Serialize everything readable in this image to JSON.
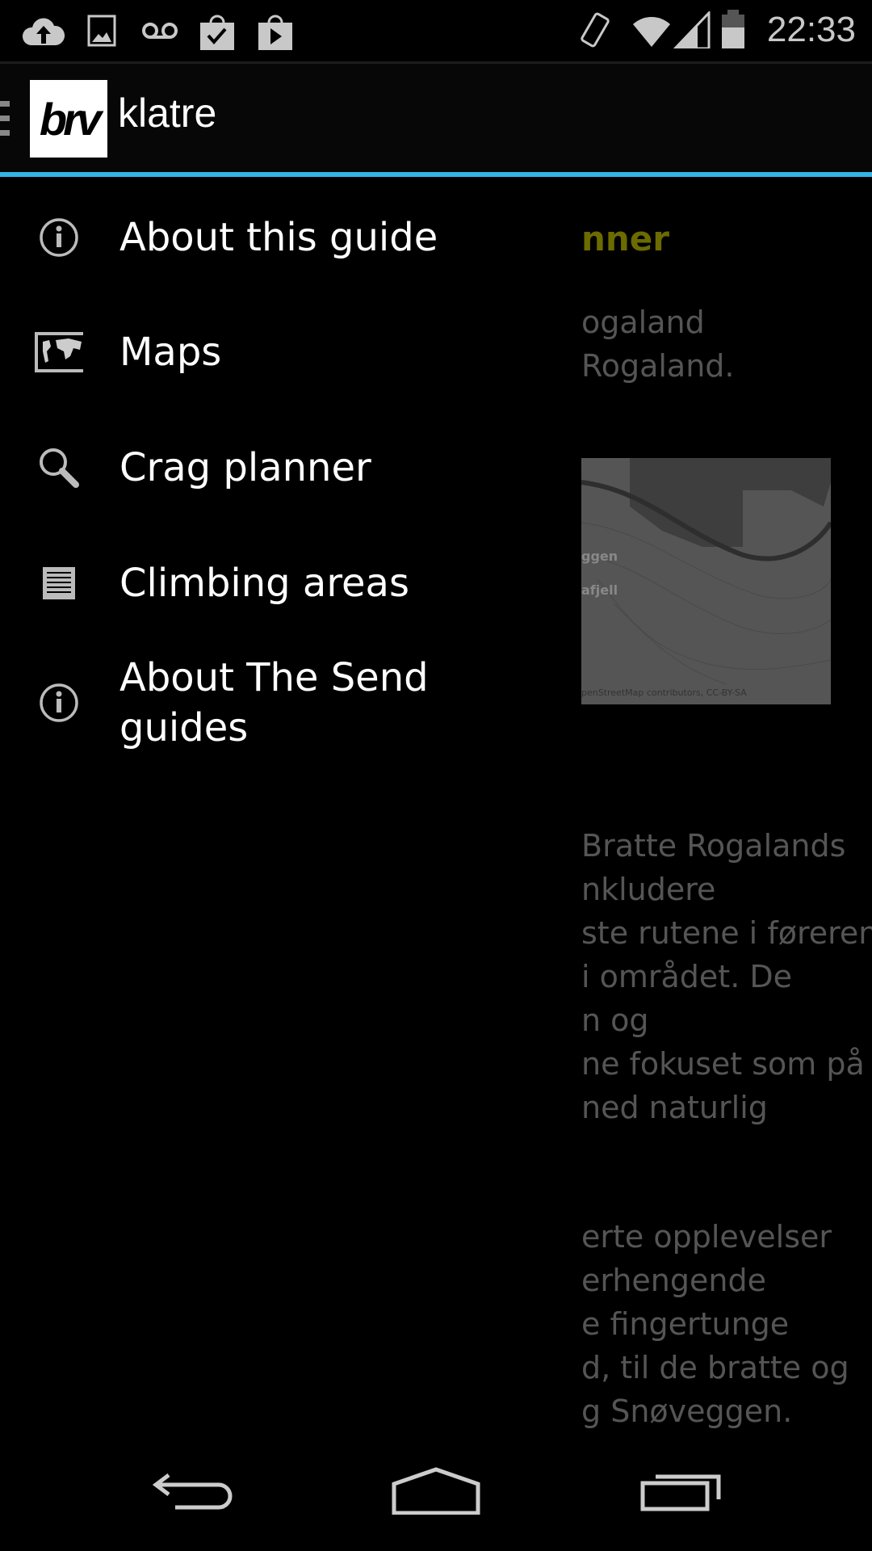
{
  "status_bar": {
    "icons_left": [
      "cloud-upload-icon",
      "image-icon",
      "voicemail-icon",
      "task-bag-icon",
      "play-store-icon"
    ],
    "icons_right": [
      "rotate-icon",
      "wifi-icon",
      "signal-icon",
      "battery-icon"
    ],
    "time": "22:33"
  },
  "action_bar": {
    "logo_text": "brv",
    "title": "klatre",
    "accent_color": "#33b5e5"
  },
  "drawer": {
    "items": [
      {
        "label": "About this guide",
        "icon": "info-icon"
      },
      {
        "label": "Maps",
        "icon": "world-map-icon"
      },
      {
        "label": "Crag planner",
        "icon": "search-icon"
      },
      {
        "label": "Climbing areas",
        "icon": "list-icon"
      },
      {
        "label": "About The Send guides",
        "icon": "info-icon"
      }
    ]
  },
  "background_content": {
    "heading": "nner",
    "heading_color": "#6b6b00",
    "intro_lines": [
      "ogaland",
      "Rogaland."
    ],
    "map_caption": "penStreetMap contributors, CC-BY-SA",
    "map_labels": [
      "ggen",
      "afjell"
    ],
    "paragraph1": [
      "Bratte Rogalands",
      "nkludere",
      "ste rutene i føreren",
      "i området. De",
      "n og",
      "ne fokuset som på",
      "ned naturlig"
    ],
    "paragraph2": [
      "erte opplevelser",
      "erhengende",
      "e fingertunge",
      "d, til de bratte og",
      "g Snøveggen."
    ]
  },
  "nav_bar": {
    "buttons": [
      "back-icon",
      "home-icon",
      "recents-icon"
    ]
  }
}
